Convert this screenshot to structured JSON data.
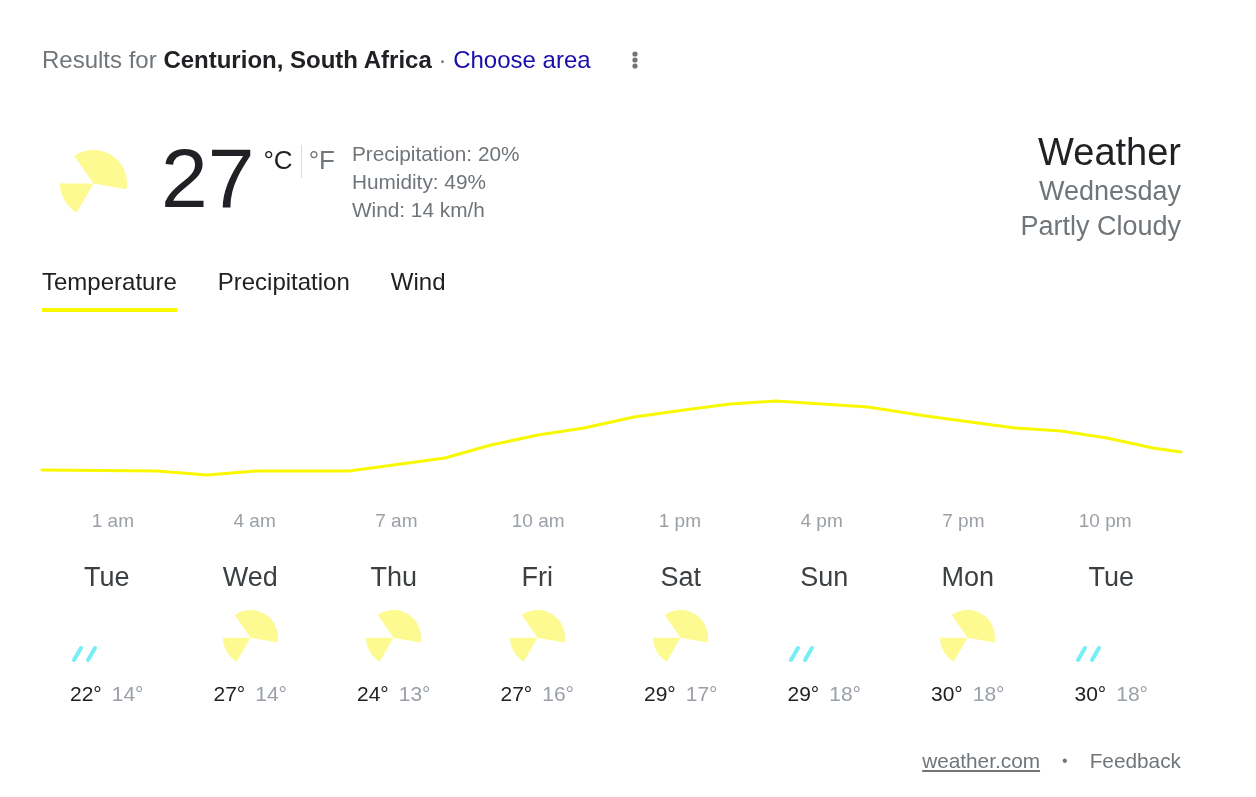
{
  "header": {
    "results_for": "Results for **Centurion, South Africa** ·",
    "link": "Choose area"
  },
  "current": {
    "kind": "partly-cloudy",
    "temperature": "27",
    "units": [
      {
        "label": "°C",
        "selected": true
      },
      {
        "label": "°F",
        "selected": false
      }
    ],
    "details": [
      "Precipitation: 20%",
      "Humidity: 49%",
      "Wind: 14 km/h"
    ]
  },
  "summary": {
    "title": "Weather",
    "day": "Wednesday",
    "condition": "Partly Cloudy"
  },
  "tabs": [
    {
      "label": "Temperature",
      "selected": true
    },
    {
      "label": "Precipitation",
      "selected": false
    },
    {
      "label": "Wind",
      "selected": false
    }
  ],
  "hours": [
    "1 am",
    "4 am",
    "7 am",
    "10 am",
    "1 pm",
    "4 pm",
    "7 pm",
    "10 pm"
  ],
  "forecast": [
    {
      "day": "Tue",
      "kind": "rain",
      "high": "22°",
      "low": "14°"
    },
    {
      "day": "Wed",
      "kind": "partly-cloudy",
      "high": "27°",
      "low": "14°"
    },
    {
      "day": "Thu",
      "kind": "partly-cloudy",
      "high": "24°",
      "low": "13°"
    },
    {
      "day": "Fri",
      "kind": "partly-cloudy",
      "high": "27°",
      "low": "16°"
    },
    {
      "day": "Sat",
      "kind": "partly-cloudy",
      "high": "29°",
      "low": "17°"
    },
    {
      "day": "Sun",
      "kind": "rain",
      "high": "29°",
      "low": "18°"
    },
    {
      "day": "Mon",
      "kind": "partly-cloudy",
      "high": "30°",
      "low": "18°"
    },
    {
      "day": "Tue",
      "kind": "rain",
      "high": "30°",
      "low": "18°"
    }
  ],
  "footer": {
    "source": "weather.com",
    "separator": "•",
    "feedback": "Feedback"
  }
}
